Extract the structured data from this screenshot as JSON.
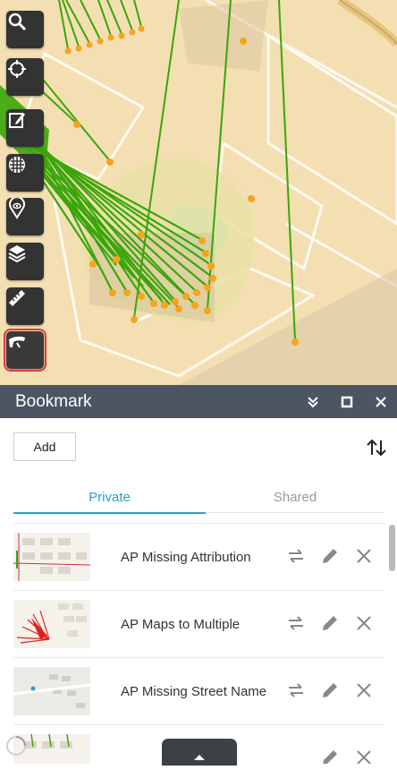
{
  "toolbar": {
    "tools": [
      {
        "name": "search-icon"
      },
      {
        "name": "locate-icon"
      },
      {
        "name": "edit-icon"
      },
      {
        "name": "basemap-icon"
      },
      {
        "name": "marker-icon"
      },
      {
        "name": "layers-icon"
      },
      {
        "name": "measure-icon"
      },
      {
        "name": "bookmark-icon",
        "active": true
      }
    ]
  },
  "panel": {
    "title": "Bookmark",
    "add_label": "Add",
    "tabs": [
      {
        "label": "Private",
        "active": true
      },
      {
        "label": "Shared",
        "active": false
      }
    ],
    "bookmarks": [
      {
        "label": "AP Missing Attribution"
      },
      {
        "label": "AP Maps to Multiple"
      },
      {
        "label": "AP Missing Street Name"
      },
      {
        "label": ""
      }
    ]
  },
  "colors": {
    "header": "#4b5662",
    "tab_accent": "#2aa3bf",
    "map_land": "#f4dfb2",
    "green_line": "#3aa60a",
    "orange_point": "#f6a41d",
    "tool_highlight": "#e0393e"
  }
}
